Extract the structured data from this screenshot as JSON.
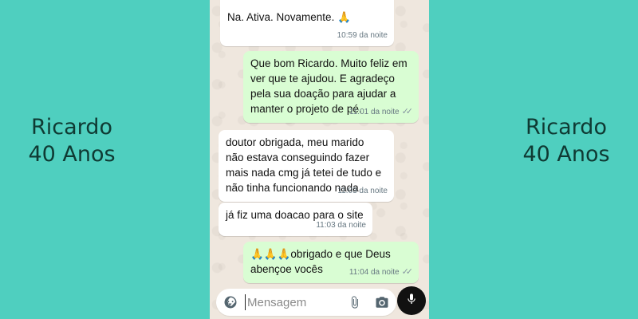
{
  "caption": {
    "name": "Ricardo",
    "age": "40 Anos"
  },
  "messages": [
    {
      "direction": "in",
      "text": "Na. Ativa. Novamente. 🙏",
      "time": "10:59 da noite"
    },
    {
      "direction": "out",
      "text": "Que bom Ricardo. Muito feliz em\nver que te ajudou. E agradeço\npela sua doação para ajudar a\nmanter o projeto de pé.",
      "time": "11:01 da noite",
      "status": "read"
    },
    {
      "direction": "in",
      "text": "doutor obrigada, meu marido\nnão estava conseguindo fazer\nmais nada cmg já tetei de tudo e\nnão tinha funcionando nada",
      "time": "11:03 da noite"
    },
    {
      "direction": "in",
      "text": "já fiz uma doacao para o site",
      "time": "11:03 da noite"
    },
    {
      "direction": "out",
      "text": "🙏🙏🙏obrigado e que Deus\nabençoe vocês",
      "time": "11:04 da noite",
      "status": "read"
    }
  ],
  "composer": {
    "placeholder": "Mensagem",
    "icons": [
      "sticker-icon",
      "attach-icon",
      "camera-icon",
      "mic-icon"
    ]
  },
  "colors": {
    "background": "#4fcfbf",
    "caption": "#0f3a33",
    "outgoing_bubble": "#d9fdd3",
    "incoming_bubble": "#ffffff",
    "chat_wallpaper": "#efe7de"
  }
}
